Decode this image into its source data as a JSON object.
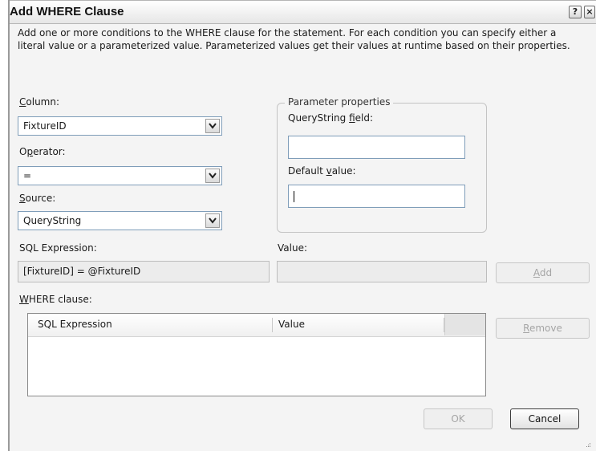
{
  "window": {
    "title": "Add WHERE Clause",
    "help_glyph": "?",
    "close_glyph": "×"
  },
  "description": "Add one or more conditions to the WHERE clause for the statement. For each condition you can specify either a literal value or a parameterized value. Parameterized values get their values at runtime based on their properties.",
  "column": {
    "label_pre": "",
    "label_key": "C",
    "label_post": "olumn:",
    "value": "FixtureID"
  },
  "operator": {
    "label_pre": "O",
    "label_key": "p",
    "label_post": "erator:",
    "value": "="
  },
  "source": {
    "label_pre": "",
    "label_key": "S",
    "label_post": "ource:",
    "value": "QueryString"
  },
  "parameter_properties": {
    "legend": "Parameter properties",
    "querystring_label_pre": "QueryString ",
    "querystring_label_key": "f",
    "querystring_label_post": "ield:",
    "querystring_value": "",
    "default_label_pre": "Default ",
    "default_label_key": "v",
    "default_label_post": "alue:",
    "default_value": ""
  },
  "sql_expression": {
    "label": "SQL Expression:",
    "value": "[FixtureID] = @FixtureID"
  },
  "value": {
    "label": "Value:",
    "value": ""
  },
  "add_button": {
    "key": "A",
    "rest": "dd"
  },
  "where_clause": {
    "label_key": "W",
    "label_rest": "HERE clause:",
    "columns": [
      "SQL Expression",
      "Value"
    ],
    "rows": []
  },
  "remove_button": {
    "key": "R",
    "rest": "emove"
  },
  "ok_button": "OK",
  "cancel_button": "Cancel"
}
